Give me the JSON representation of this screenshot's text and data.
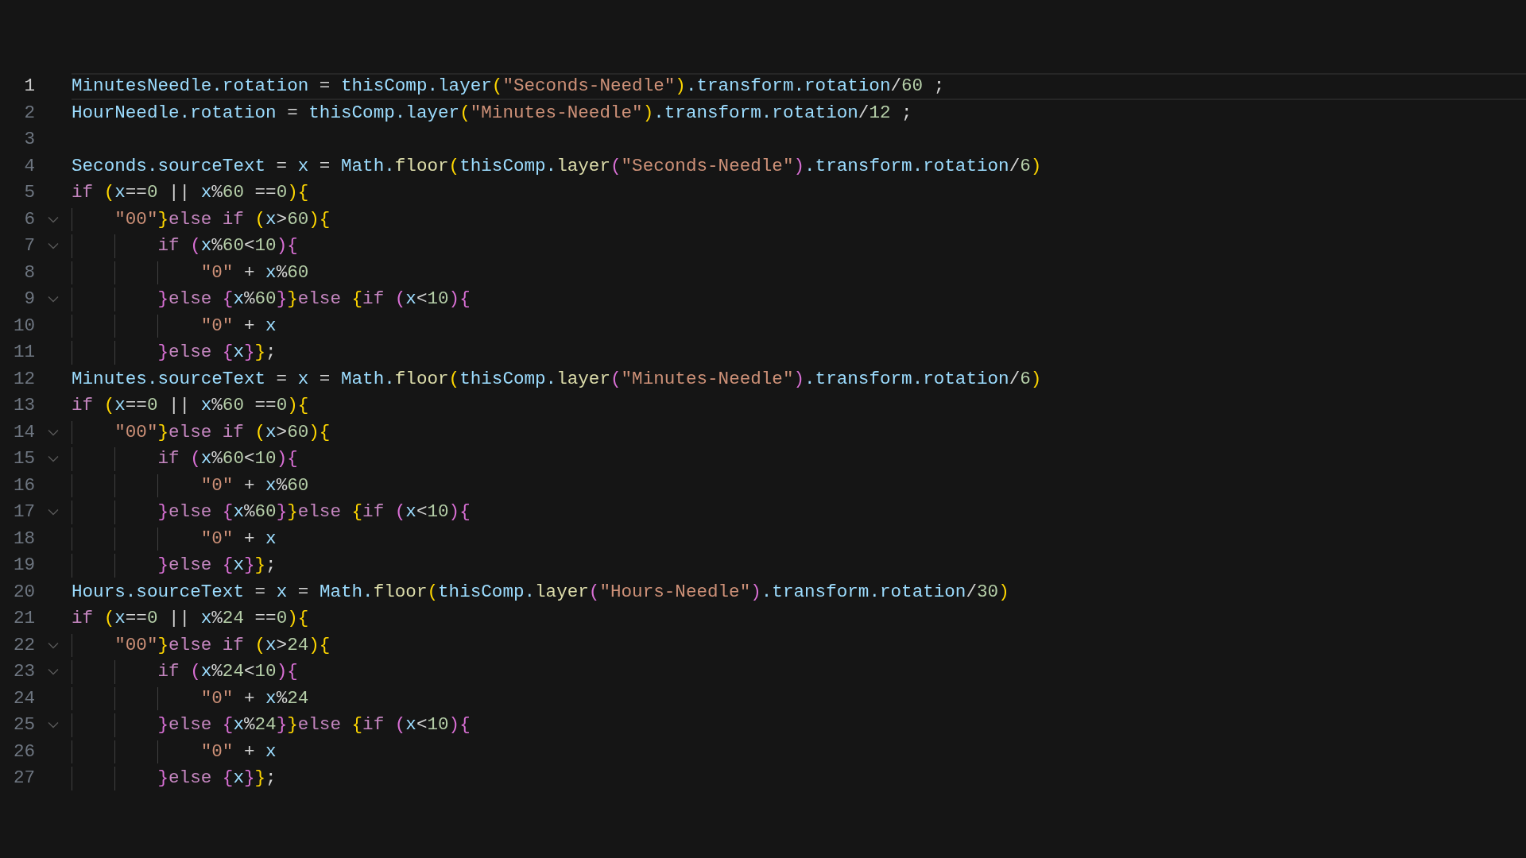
{
  "lines": [
    {
      "number": "1",
      "current": true,
      "foldable": false,
      "tokens": [
        {
          "kind": "variable",
          "text": "MinutesNeedle.rotation"
        },
        {
          "kind": "operator",
          "text": " = "
        },
        {
          "kind": "variable",
          "text": "thisComp.layer"
        },
        {
          "kind": "bracket1",
          "text": "("
        },
        {
          "kind": "string",
          "text": "\"Seconds-Needle\""
        },
        {
          "kind": "bracket1",
          "text": ")"
        },
        {
          "kind": "variable",
          "text": ".transform.rotation"
        },
        {
          "kind": "operator",
          "text": "/"
        },
        {
          "kind": "number",
          "text": "60"
        },
        {
          "kind": "operator",
          "text": " ;"
        }
      ]
    },
    {
      "number": "2",
      "current": false,
      "foldable": false,
      "tokens": [
        {
          "kind": "variable",
          "text": "HourNeedle.rotation"
        },
        {
          "kind": "operator",
          "text": " = "
        },
        {
          "kind": "variable",
          "text": "thisComp.layer"
        },
        {
          "kind": "bracket1",
          "text": "("
        },
        {
          "kind": "string",
          "text": "\"Minutes-Needle\""
        },
        {
          "kind": "bracket1",
          "text": ")"
        },
        {
          "kind": "variable",
          "text": ".transform.rotation"
        },
        {
          "kind": "operator",
          "text": "/"
        },
        {
          "kind": "number",
          "text": "12"
        },
        {
          "kind": "operator",
          "text": " ;"
        }
      ]
    },
    {
      "number": "3",
      "current": false,
      "foldable": false
    },
    {
      "number": "4",
      "current": false,
      "foldable": false,
      "tokens": [
        {
          "kind": "variable",
          "text": "Seconds.sourceText"
        },
        {
          "kind": "operator",
          "text": " = "
        },
        {
          "kind": "variable",
          "text": "x"
        },
        {
          "kind": "operator",
          "text": " = "
        },
        {
          "kind": "variable",
          "text": "Math."
        },
        {
          "kind": "function",
          "text": "floor"
        },
        {
          "kind": "bracket1",
          "text": "("
        },
        {
          "kind": "variable",
          "text": "thisComp."
        },
        {
          "kind": "function",
          "text": "layer"
        },
        {
          "kind": "bracket2",
          "text": "("
        },
        {
          "kind": "string",
          "text": "\"Seconds-Needle\""
        },
        {
          "kind": "bracket2",
          "text": ")"
        },
        {
          "kind": "variable",
          "text": ".transform.rotation"
        },
        {
          "kind": "operator",
          "text": "/"
        },
        {
          "kind": "number",
          "text": "6"
        },
        {
          "kind": "bracket1",
          "text": ")"
        }
      ]
    },
    {
      "number": "5",
      "current": false,
      "foldable": false,
      "tokens": [
        {
          "kind": "keyword",
          "text": "if "
        },
        {
          "kind": "bracket1",
          "text": "("
        },
        {
          "kind": "variable",
          "text": "x"
        },
        {
          "kind": "operator",
          "text": "=="
        },
        {
          "kind": "number",
          "text": "0"
        },
        {
          "kind": "operator",
          "text": " || "
        },
        {
          "kind": "variable",
          "text": "x"
        },
        {
          "kind": "operator",
          "text": "%"
        },
        {
          "kind": "number",
          "text": "60"
        },
        {
          "kind": "operator",
          "text": " =="
        },
        {
          "kind": "number",
          "text": "0"
        },
        {
          "kind": "bracket1",
          "text": ")"
        },
        {
          "kind": "bracket1",
          "text": "{"
        }
      ],
      "children": [
        {
          "number": "6",
          "current": false,
          "foldable": true,
          "tokens": [
            {
              "kind": "string",
              "text": "\"00\""
            },
            {
              "kind": "bracket1",
              "text": "}"
            },
            {
              "kind": "keyword",
              "text": "else if "
            },
            {
              "kind": "bracket1",
              "text": "("
            },
            {
              "kind": "variable",
              "text": "x"
            },
            {
              "kind": "operator",
              "text": ">"
            },
            {
              "kind": "number",
              "text": "60"
            },
            {
              "kind": "bracket1",
              "text": ")"
            },
            {
              "kind": "bracket1",
              "text": "{"
            }
          ],
          "children": [
            {
              "number": "7",
              "current": false,
              "foldable": true,
              "tokens": [
                {
                  "kind": "keyword",
                  "text": "if "
                },
                {
                  "kind": "bracket2",
                  "text": "("
                },
                {
                  "kind": "variable",
                  "text": "x"
                },
                {
                  "kind": "operator",
                  "text": "%"
                },
                {
                  "kind": "number",
                  "text": "60"
                },
                {
                  "kind": "operator",
                  "text": "<"
                },
                {
                  "kind": "number",
                  "text": "10"
                },
                {
                  "kind": "bracket2",
                  "text": ")"
                },
                {
                  "kind": "bracket2",
                  "text": "{"
                }
              ],
              "children": [
                {
                  "number": "8",
                  "current": false,
                  "foldable": false,
                  "tokens": [
                    {
                      "kind": "string",
                      "text": "\"0\""
                    },
                    {
                      "kind": "operator",
                      "text": " + "
                    },
                    {
                      "kind": "variable",
                      "text": "x"
                    },
                    {
                      "kind": "operator",
                      "text": "%"
                    },
                    {
                      "kind": "number",
                      "text": "60"
                    }
                  ]
                }
              ]
            },
            {
              "number": "9",
              "current": false,
              "foldable": true,
              "tokens": [
                {
                  "kind": "bracket2",
                  "text": "}"
                },
                {
                  "kind": "keyword",
                  "text": "else "
                },
                {
                  "kind": "bracket2",
                  "text": "{"
                },
                {
                  "kind": "variable",
                  "text": "x"
                },
                {
                  "kind": "operator",
                  "text": "%"
                },
                {
                  "kind": "number",
                  "text": "60"
                },
                {
                  "kind": "bracket2",
                  "text": "}"
                },
                {
                  "kind": "bracket1",
                  "text": "}"
                },
                {
                  "kind": "keyword",
                  "text": "else "
                },
                {
                  "kind": "bracket1",
                  "text": "{"
                },
                {
                  "kind": "keyword",
                  "text": "if "
                },
                {
                  "kind": "bracket2",
                  "text": "("
                },
                {
                  "kind": "variable",
                  "text": "x"
                },
                {
                  "kind": "operator",
                  "text": "<"
                },
                {
                  "kind": "number",
                  "text": "10"
                },
                {
                  "kind": "bracket2",
                  "text": ")"
                },
                {
                  "kind": "bracket2",
                  "text": "{"
                }
              ],
              "children": [
                {
                  "number": "10",
                  "current": false,
                  "foldable": false,
                  "tokens": [
                    {
                      "kind": "string",
                      "text": "\"0\""
                    },
                    {
                      "kind": "operator",
                      "text": " + "
                    },
                    {
                      "kind": "variable",
                      "text": "x"
                    }
                  ]
                }
              ]
            },
            {
              "number": "11",
              "current": false,
              "foldable": false,
              "tokens": [
                {
                  "kind": "bracket2",
                  "text": "}"
                },
                {
                  "kind": "keyword",
                  "text": "else "
                },
                {
                  "kind": "bracket2",
                  "text": "{"
                },
                {
                  "kind": "variable",
                  "text": "x"
                },
                {
                  "kind": "bracket2",
                  "text": "}"
                },
                {
                  "kind": "bracket1",
                  "text": "}"
                },
                {
                  "kind": "operator",
                  "text": ";"
                }
              ]
            }
          ]
        }
      ]
    },
    {
      "number": "12",
      "current": false,
      "foldable": false,
      "tokens": [
        {
          "kind": "variable",
          "text": "Minutes.sourceText"
        },
        {
          "kind": "operator",
          "text": " = "
        },
        {
          "kind": "variable",
          "text": "x"
        },
        {
          "kind": "operator",
          "text": " = "
        },
        {
          "kind": "variable",
          "text": "Math."
        },
        {
          "kind": "function",
          "text": "floor"
        },
        {
          "kind": "bracket1",
          "text": "("
        },
        {
          "kind": "variable",
          "text": "thisComp."
        },
        {
          "kind": "function",
          "text": "layer"
        },
        {
          "kind": "bracket2",
          "text": "("
        },
        {
          "kind": "string",
          "text": "\"Minutes-Needle\""
        },
        {
          "kind": "bracket2",
          "text": ")"
        },
        {
          "kind": "variable",
          "text": ".transform.rotation"
        },
        {
          "kind": "operator",
          "text": "/"
        },
        {
          "kind": "number",
          "text": "6"
        },
        {
          "kind": "bracket1",
          "text": ")"
        }
      ]
    },
    {
      "number": "13",
      "current": false,
      "foldable": false,
      "tokens": [
        {
          "kind": "keyword",
          "text": "if "
        },
        {
          "kind": "bracket1",
          "text": "("
        },
        {
          "kind": "variable",
          "text": "x"
        },
        {
          "kind": "operator",
          "text": "=="
        },
        {
          "kind": "number",
          "text": "0"
        },
        {
          "kind": "operator",
          "text": " || "
        },
        {
          "kind": "variable",
          "text": "x"
        },
        {
          "kind": "operator",
          "text": "%"
        },
        {
          "kind": "number",
          "text": "60"
        },
        {
          "kind": "operator",
          "text": " =="
        },
        {
          "kind": "number",
          "text": "0"
        },
        {
          "kind": "bracket1",
          "text": ")"
        },
        {
          "kind": "bracket1",
          "text": "{"
        }
      ],
      "children": [
        {
          "number": "14",
          "current": false,
          "foldable": true,
          "tokens": [
            {
              "kind": "string",
              "text": "\"00\""
            },
            {
              "kind": "bracket1",
              "text": "}"
            },
            {
              "kind": "keyword",
              "text": "else if "
            },
            {
              "kind": "bracket1",
              "text": "("
            },
            {
              "kind": "variable",
              "text": "x"
            },
            {
              "kind": "operator",
              "text": ">"
            },
            {
              "kind": "number",
              "text": "60"
            },
            {
              "kind": "bracket1",
              "text": ")"
            },
            {
              "kind": "bracket1",
              "text": "{"
            }
          ],
          "children": [
            {
              "number": "15",
              "current": false,
              "foldable": true,
              "tokens": [
                {
                  "kind": "keyword",
                  "text": "if "
                },
                {
                  "kind": "bracket2",
                  "text": "("
                },
                {
                  "kind": "variable",
                  "text": "x"
                },
                {
                  "kind": "operator",
                  "text": "%"
                },
                {
                  "kind": "number",
                  "text": "60"
                },
                {
                  "kind": "operator",
                  "text": "<"
                },
                {
                  "kind": "number",
                  "text": "10"
                },
                {
                  "kind": "bracket2",
                  "text": ")"
                },
                {
                  "kind": "bracket2",
                  "text": "{"
                }
              ],
              "children": [
                {
                  "number": "16",
                  "current": false,
                  "foldable": false,
                  "tokens": [
                    {
                      "kind": "string",
                      "text": "\"0\""
                    },
                    {
                      "kind": "operator",
                      "text": " + "
                    },
                    {
                      "kind": "variable",
                      "text": "x"
                    },
                    {
                      "kind": "operator",
                      "text": "%"
                    },
                    {
                      "kind": "number",
                      "text": "60"
                    }
                  ]
                }
              ]
            },
            {
              "number": "17",
              "current": false,
              "foldable": true,
              "tokens": [
                {
                  "kind": "bracket2",
                  "text": "}"
                },
                {
                  "kind": "keyword",
                  "text": "else "
                },
                {
                  "kind": "bracket2",
                  "text": "{"
                },
                {
                  "kind": "variable",
                  "text": "x"
                },
                {
                  "kind": "operator",
                  "text": "%"
                },
                {
                  "kind": "number",
                  "text": "60"
                },
                {
                  "kind": "bracket2",
                  "text": "}"
                },
                {
                  "kind": "bracket1",
                  "text": "}"
                },
                {
                  "kind": "keyword",
                  "text": "else "
                },
                {
                  "kind": "bracket1",
                  "text": "{"
                },
                {
                  "kind": "keyword",
                  "text": "if "
                },
                {
                  "kind": "bracket2",
                  "text": "("
                },
                {
                  "kind": "variable",
                  "text": "x"
                },
                {
                  "kind": "operator",
                  "text": "<"
                },
                {
                  "kind": "number",
                  "text": "10"
                },
                {
                  "kind": "bracket2",
                  "text": ")"
                },
                {
                  "kind": "bracket2",
                  "text": "{"
                }
              ],
              "children": [
                {
                  "number": "18",
                  "current": false,
                  "foldable": false,
                  "tokens": [
                    {
                      "kind": "string",
                      "text": "\"0\""
                    },
                    {
                      "kind": "operator",
                      "text": " + "
                    },
                    {
                      "kind": "variable",
                      "text": "x"
                    }
                  ]
                }
              ]
            },
            {
              "number": "19",
              "current": false,
              "foldable": false,
              "tokens": [
                {
                  "kind": "bracket2",
                  "text": "}"
                },
                {
                  "kind": "keyword",
                  "text": "else "
                },
                {
                  "kind": "bracket2",
                  "text": "{"
                },
                {
                  "kind": "variable",
                  "text": "x"
                },
                {
                  "kind": "bracket2",
                  "text": "}"
                },
                {
                  "kind": "bracket1",
                  "text": "}"
                },
                {
                  "kind": "operator",
                  "text": ";"
                }
              ]
            }
          ]
        }
      ]
    },
    {
      "number": "20",
      "current": false,
      "foldable": false,
      "tokens": [
        {
          "kind": "variable",
          "text": "Hours.sourceText"
        },
        {
          "kind": "operator",
          "text": " = "
        },
        {
          "kind": "variable",
          "text": "x"
        },
        {
          "kind": "operator",
          "text": " = "
        },
        {
          "kind": "variable",
          "text": "Math."
        },
        {
          "kind": "function",
          "text": "floor"
        },
        {
          "kind": "bracket1",
          "text": "("
        },
        {
          "kind": "variable",
          "text": "thisComp."
        },
        {
          "kind": "function",
          "text": "layer"
        },
        {
          "kind": "bracket2",
          "text": "("
        },
        {
          "kind": "string",
          "text": "\"Hours-Needle\""
        },
        {
          "kind": "bracket2",
          "text": ")"
        },
        {
          "kind": "variable",
          "text": ".transform.rotation"
        },
        {
          "kind": "operator",
          "text": "/"
        },
        {
          "kind": "number",
          "text": "30"
        },
        {
          "kind": "bracket1",
          "text": ")"
        }
      ]
    },
    {
      "number": "21",
      "current": false,
      "foldable": false,
      "tokens": [
        {
          "kind": "keyword",
          "text": "if "
        },
        {
          "kind": "bracket1",
          "text": "("
        },
        {
          "kind": "variable",
          "text": "x"
        },
        {
          "kind": "operator",
          "text": "=="
        },
        {
          "kind": "number",
          "text": "0"
        },
        {
          "kind": "operator",
          "text": " || "
        },
        {
          "kind": "variable",
          "text": "x"
        },
        {
          "kind": "operator",
          "text": "%"
        },
        {
          "kind": "number",
          "text": "24"
        },
        {
          "kind": "operator",
          "text": " =="
        },
        {
          "kind": "number",
          "text": "0"
        },
        {
          "kind": "bracket1",
          "text": ")"
        },
        {
          "kind": "bracket1",
          "text": "{"
        }
      ],
      "children": [
        {
          "number": "22",
          "current": false,
          "foldable": true,
          "tokens": [
            {
              "kind": "string",
              "text": "\"00\""
            },
            {
              "kind": "bracket1",
              "text": "}"
            },
            {
              "kind": "keyword",
              "text": "else if "
            },
            {
              "kind": "bracket1",
              "text": "("
            },
            {
              "kind": "variable",
              "text": "x"
            },
            {
              "kind": "operator",
              "text": ">"
            },
            {
              "kind": "number",
              "text": "24"
            },
            {
              "kind": "bracket1",
              "text": ")"
            },
            {
              "kind": "bracket1",
              "text": "{"
            }
          ],
          "children": [
            {
              "number": "23",
              "current": false,
              "foldable": true,
              "tokens": [
                {
                  "kind": "keyword",
                  "text": "if "
                },
                {
                  "kind": "bracket2",
                  "text": "("
                },
                {
                  "kind": "variable",
                  "text": "x"
                },
                {
                  "kind": "operator",
                  "text": "%"
                },
                {
                  "kind": "number",
                  "text": "24"
                },
                {
                  "kind": "operator",
                  "text": "<"
                },
                {
                  "kind": "number",
                  "text": "10"
                },
                {
                  "kind": "bracket2",
                  "text": ")"
                },
                {
                  "kind": "bracket2",
                  "text": "{"
                }
              ],
              "children": [
                {
                  "number": "24",
                  "current": false,
                  "foldable": false,
                  "tokens": [
                    {
                      "kind": "string",
                      "text": "\"0\""
                    },
                    {
                      "kind": "operator",
                      "text": " + "
                    },
                    {
                      "kind": "variable",
                      "text": "x"
                    },
                    {
                      "kind": "operator",
                      "text": "%"
                    },
                    {
                      "kind": "number",
                      "text": "24"
                    }
                  ]
                }
              ]
            },
            {
              "number": "25",
              "current": false,
              "foldable": true,
              "tokens": [
                {
                  "kind": "bracket2",
                  "text": "}"
                },
                {
                  "kind": "keyword",
                  "text": "else "
                },
                {
                  "kind": "bracket2",
                  "text": "{"
                },
                {
                  "kind": "variable",
                  "text": "x"
                },
                {
                  "kind": "operator",
                  "text": "%"
                },
                {
                  "kind": "number",
                  "text": "24"
                },
                {
                  "kind": "bracket2",
                  "text": "}"
                },
                {
                  "kind": "bracket1",
                  "text": "}"
                },
                {
                  "kind": "keyword",
                  "text": "else "
                },
                {
                  "kind": "bracket1",
                  "text": "{"
                },
                {
                  "kind": "keyword",
                  "text": "if "
                },
                {
                  "kind": "bracket2",
                  "text": "("
                },
                {
                  "kind": "variable",
                  "text": "x"
                },
                {
                  "kind": "operator",
                  "text": "<"
                },
                {
                  "kind": "number",
                  "text": "10"
                },
                {
                  "kind": "bracket2",
                  "text": ")"
                },
                {
                  "kind": "bracket2",
                  "text": "{"
                }
              ],
              "children": [
                {
                  "number": "26",
                  "current": false,
                  "foldable": false,
                  "tokens": [
                    {
                      "kind": "string",
                      "text": "\"0\""
                    },
                    {
                      "kind": "operator",
                      "text": " + "
                    },
                    {
                      "kind": "variable",
                      "text": "x"
                    }
                  ]
                }
              ]
            },
            {
              "number": "27",
              "current": false,
              "foldable": false,
              "tokens": [
                {
                  "kind": "bracket2",
                  "text": "}"
                },
                {
                  "kind": "keyword",
                  "text": "else "
                },
                {
                  "kind": "bracket2",
                  "text": "{"
                },
                {
                  "kind": "variable",
                  "text": "x"
                },
                {
                  "kind": "bracket2",
                  "text": "}"
                },
                {
                  "kind": "bracket1",
                  "text": "}"
                },
                {
                  "kind": "operator",
                  "text": ";"
                }
              ]
            }
          ]
        }
      ]
    }
  ]
}
